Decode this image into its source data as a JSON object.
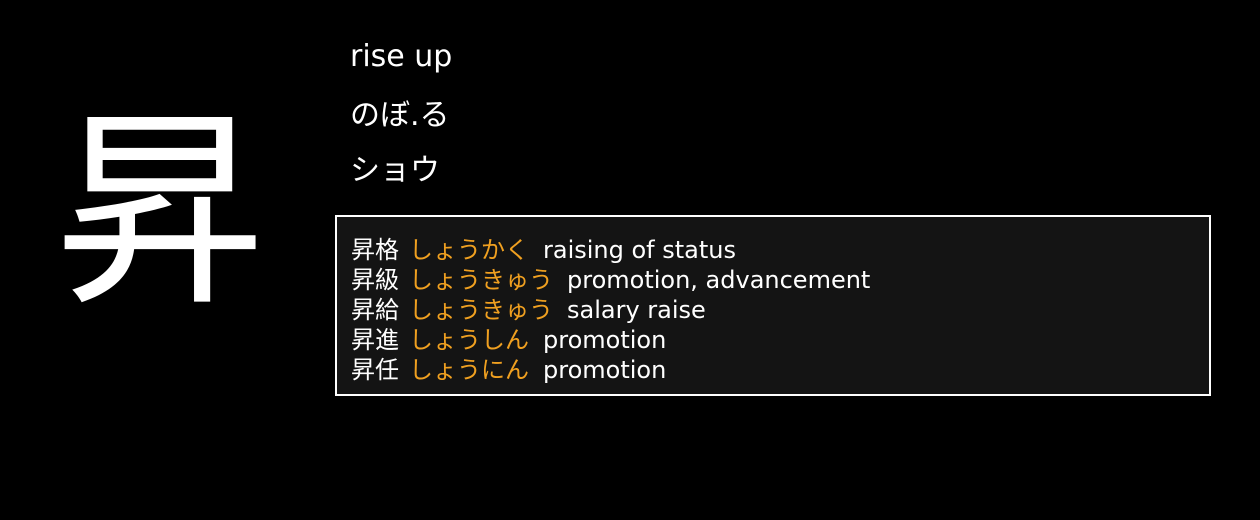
{
  "kanji": "昇",
  "meaning": "rise up",
  "kun_reading": "のぼ.る",
  "on_reading": "ショウ",
  "colors": {
    "background": "#000000",
    "text": "#ffffff",
    "reading": "#f0a020",
    "panel": "#141414",
    "panel_border": "#ffffff"
  },
  "examples": [
    {
      "word": "昇格",
      "reading": "しょうかく",
      "gloss": "raising of status"
    },
    {
      "word": "昇級",
      "reading": "しょうきゅう",
      "gloss": "promotion, advancement"
    },
    {
      "word": "昇給",
      "reading": "しょうきゅう",
      "gloss": "salary raise"
    },
    {
      "word": "昇進",
      "reading": "しょうしん",
      "gloss": "promotion"
    },
    {
      "word": "昇任",
      "reading": "しょうにん",
      "gloss": "promotion"
    }
  ]
}
